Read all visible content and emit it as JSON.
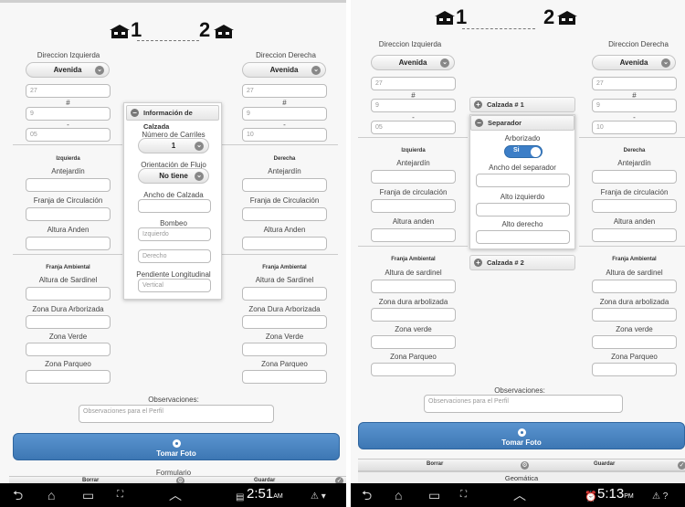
{
  "left": {
    "header": {
      "num1": "1",
      "num2": "2"
    },
    "dir_izq": "Direccion Izquierda",
    "dir_der": "Direccion Derecha",
    "select_izq": "Avenida",
    "select_der": "Avenida",
    "izq_fields": {
      "f1": "27",
      "hash": "#",
      "f2": "9",
      "dash": "-",
      "f3": "05"
    },
    "der_fields": {
      "f1": "27",
      "hash": "#",
      "f2": "9",
      "dash": "-",
      "f3": "10"
    },
    "sec_izquierda": "Izquierda",
    "sec_derecha": "Derecha",
    "antejardin": "Antejardín",
    "franja": "Franja de Circulación",
    "altura_anden": "Altura Anden",
    "franja_ambiental": "Franja Ambiental",
    "altura_sardinel": "Altura de Sardinel",
    "zona_dura": "Zona Dura Arborizada",
    "zona_verde": "Zona Verde",
    "zona_parqueo": "Zona Parqueo",
    "popup": {
      "title": "Información de Calzada",
      "num_carriles": "Número de Carriles",
      "carriles_value": "1",
      "orientacion": "Orientación de Flujo",
      "orientacion_value": "No tiene",
      "ancho": "Ancho de Calzada",
      "bombeo": "Bombeo",
      "bombeo_izq_ph": "Izquierdo",
      "bombeo_der_ph": "Derecho",
      "pendiente": "Pendiente Longitudinal",
      "pendiente_ph": "Vertical"
    },
    "observaciones": "Observaciones:",
    "obs_placeholder": "Observaciones para el Perfil",
    "tomar_foto": "Tomar Foto",
    "formulario": "Formulario",
    "borrar": "Borrar",
    "guardar": "Guardar",
    "clock": "2:51",
    "clock_ampm": "AM"
  },
  "right": {
    "header": {
      "num1": "1",
      "num2": "2"
    },
    "dir_izq": "Direccion Izquierda",
    "dir_der": "Direccion Derecha",
    "select_izq": "Avenida",
    "select_der": "Avenida",
    "izq_fields": {
      "f1": "27",
      "hash": "#",
      "f2": "9",
      "dash": "-",
      "f3": "05"
    },
    "der_fields": {
      "f1": "27",
      "hash": "#",
      "f2": "9",
      "dash": "-",
      "f3": "10"
    },
    "sec_izquierda": "Izquierda",
    "sec_derecha": "Derecha",
    "antejardin": "Antejardín",
    "franja": "Franja de circulación",
    "altura_anden": "Altura anden",
    "franja_ambiental": "Franja Ambiental",
    "altura_sardinel": "Altura de sardinel",
    "zona_dura": "Zona dura arbolizada",
    "zona_verde": "Zona verde",
    "zona_parqueo": "Zona Parqueo",
    "calzada1": "Calzada # 1",
    "separador": "Separador",
    "arborizado": "Arborizado",
    "toggle": "Si",
    "ancho_sep": "Ancho del separador",
    "alto_izq": "Alto izquierdo",
    "alto_der": "Alto derecho",
    "calzada2": "Calzada # 2",
    "observaciones": "Observaciones:",
    "obs_placeholder": "Observaciones para el Perfil",
    "tomar_foto": "Tomar Foto",
    "geometrica": "Geomática",
    "borrar": "Borrar",
    "guardar": "Guardar",
    "clock": "5:13",
    "clock_ampm": "PM"
  }
}
